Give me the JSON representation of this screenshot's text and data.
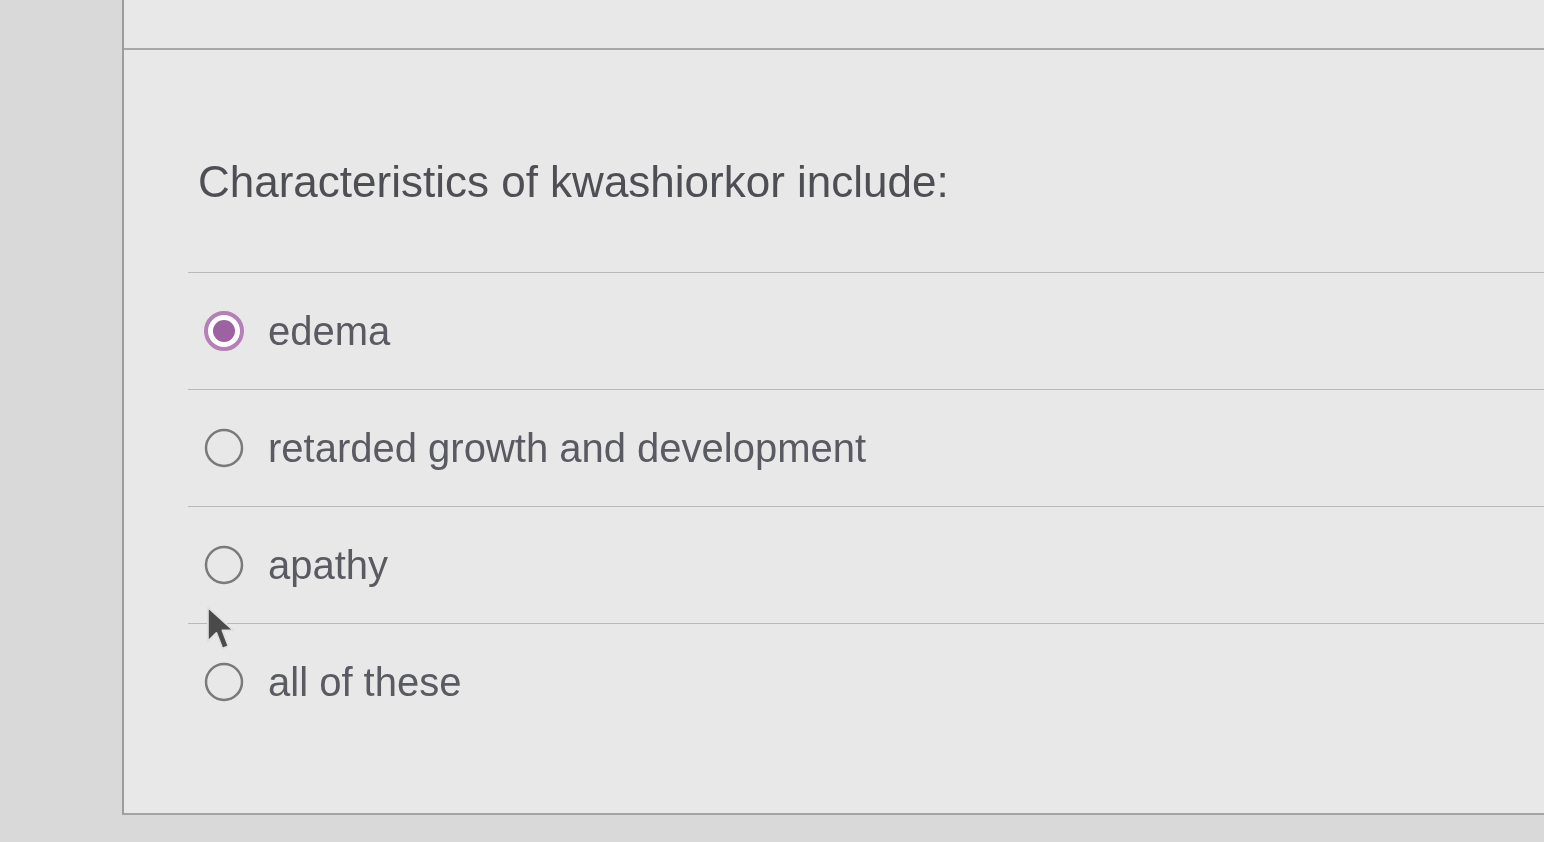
{
  "question": {
    "text": "Characteristics of kwashiorkor include:"
  },
  "options": [
    {
      "label": "edema",
      "selected": true
    },
    {
      "label": "retarded growth and development",
      "selected": false
    },
    {
      "label": "apathy",
      "selected": false
    },
    {
      "label": "all of these",
      "selected": false
    }
  ]
}
